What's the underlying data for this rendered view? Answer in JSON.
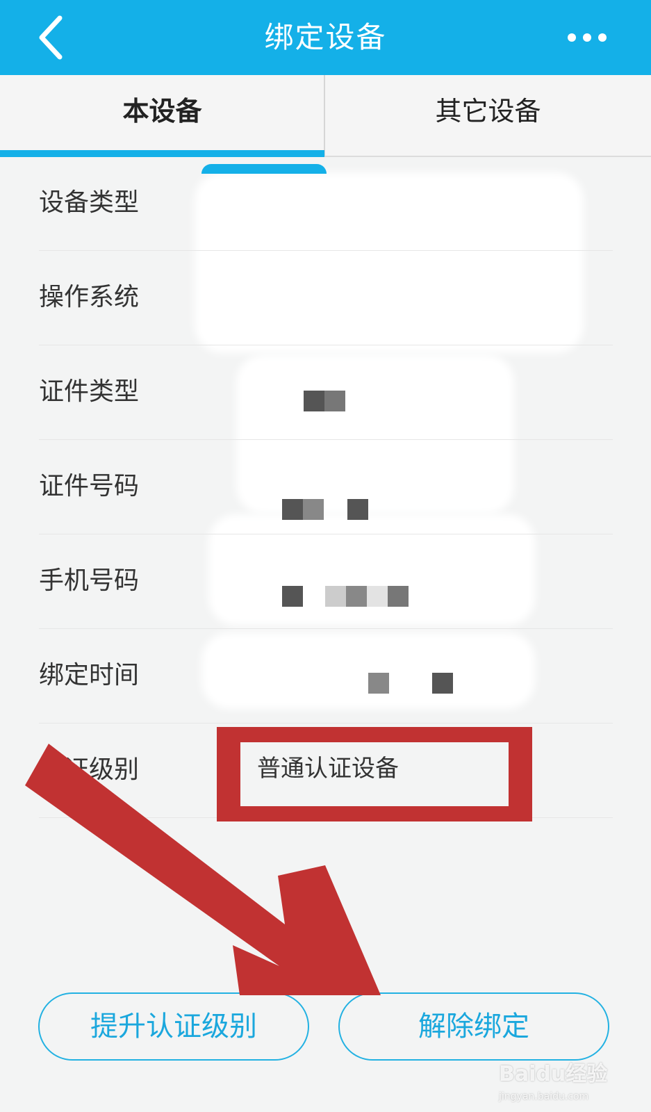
{
  "header": {
    "title": "绑定设备"
  },
  "tabs": [
    {
      "label": "本设备",
      "active": true
    },
    {
      "label": "其它设备",
      "active": false
    }
  ],
  "rows": [
    {
      "label": "设备类型"
    },
    {
      "label": "操作系统"
    },
    {
      "label": "证件类型"
    },
    {
      "label": "证件号码"
    },
    {
      "label": "手机号码"
    },
    {
      "label": "绑定时间"
    },
    {
      "label": "认证级别",
      "value": "普通认证设备"
    }
  ],
  "buttons": {
    "upgrade": "提升认证级别",
    "unbind": "解除绑定"
  },
  "watermark": {
    "logo_text": "Baidu经验",
    "url": "jingyan.baidu.com"
  },
  "colors": {
    "header_bg": "#14b0e8",
    "accent": "#1aa7dd",
    "annotation_red": "#c13232"
  },
  "icons": {
    "back": "chevron-left-icon",
    "more": "more-dots-icon"
  }
}
